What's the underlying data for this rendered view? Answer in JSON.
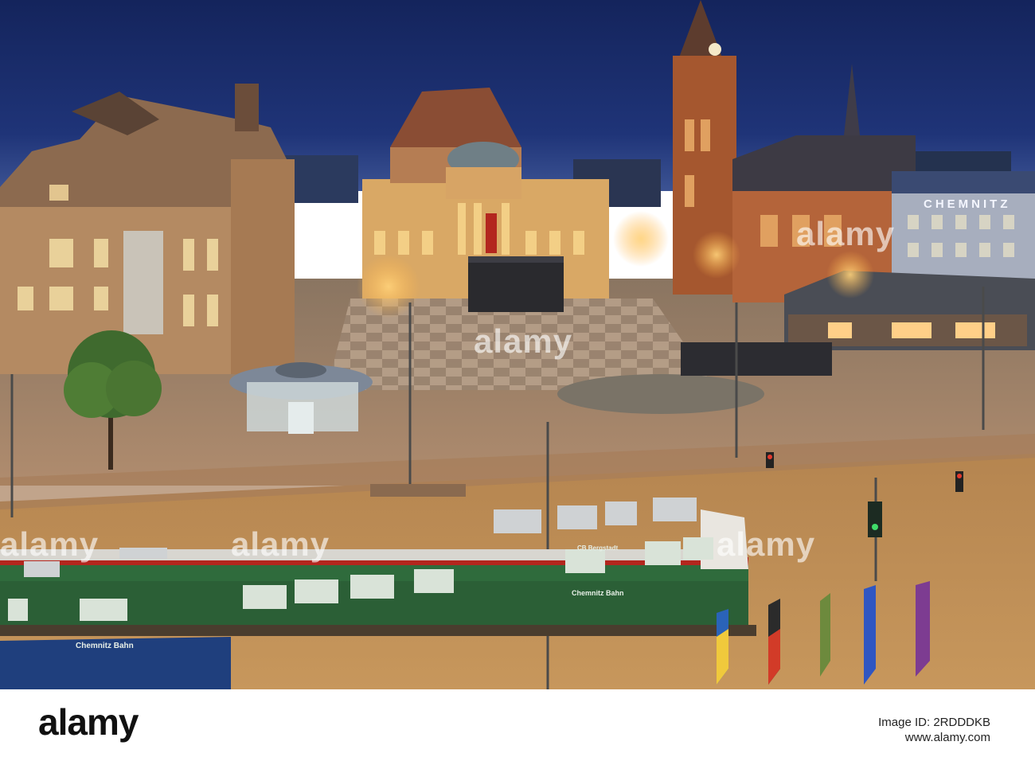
{
  "scene": {
    "description_colors": {
      "sky": "#1c2f6e",
      "sky_horizon": "#3a4f8e",
      "plaza_light": "#b99a78",
      "lamp_glow": "#ffb347",
      "opera_facade": "#e3b56a",
      "church_brick": "#b8653a",
      "tram_green": "#2f6b3c",
      "tram_red": "#b3261e"
    }
  },
  "signage": {
    "building_sign": "CHEMNITZ",
    "tram_label": "Chemnitz Bahn",
    "tram_label_2": "Chemnitz Bahn",
    "tram_brand": "CB Bergstadt"
  },
  "watermark": {
    "text_a": "alamy",
    "text_b": "alamy",
    "text_c": "alamy",
    "text_d": "alamy",
    "text_e": "alamy"
  },
  "footer": {
    "logo": "alamy",
    "image_id": "Image ID: 2RDDDKB",
    "site": "www.alamy.com"
  }
}
